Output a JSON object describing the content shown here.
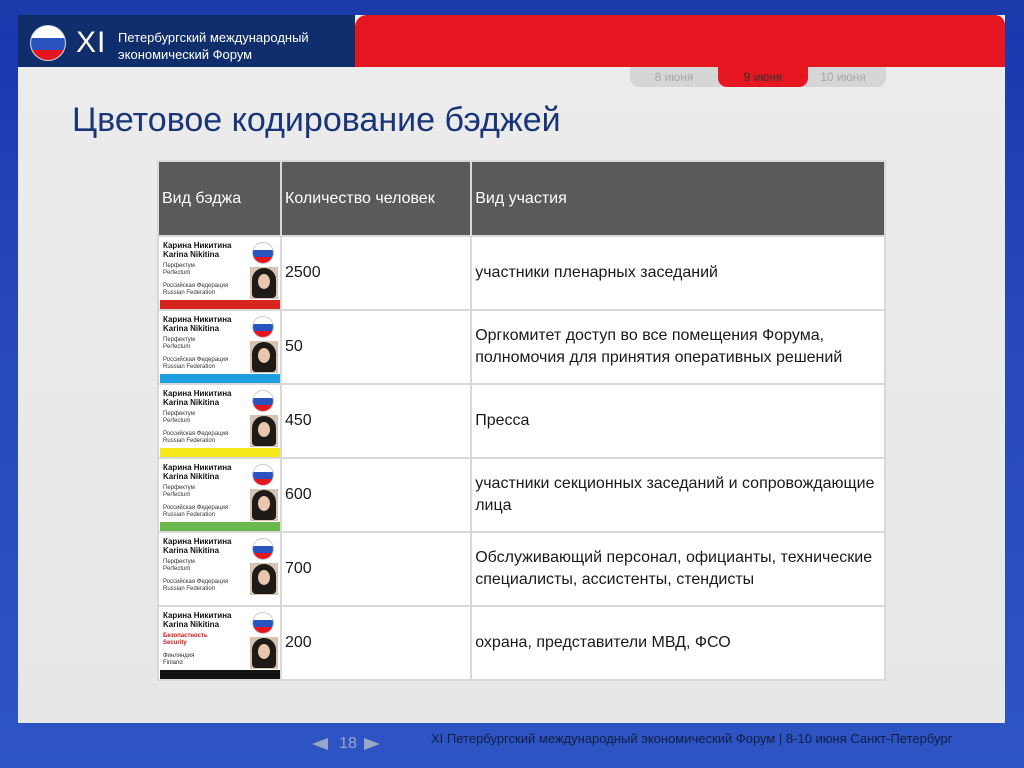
{
  "header": {
    "roman": "XI",
    "forum_name_line1": "Петербургский международный",
    "forum_name_line2": "экономический Форум"
  },
  "tabs": [
    "8 июня",
    "9 июня",
    "10 июня"
  ],
  "active_tab": "9 июня",
  "title": "Цветовое кодирование бэджей",
  "table": {
    "headers": [
      "Вид бэджа",
      "Количество человек",
      "Вид участия"
    ],
    "rows": [
      {
        "badge": {
          "name_ru": "Карина Никитина",
          "name_en": "Karina Nikitina",
          "org_ru": "Перфектум",
          "org_en": "Perfectum",
          "country_ru": "Российская Федерация",
          "country_en": "Russian Federation",
          "stripe_color": "#d7261e"
        },
        "count": "2500",
        "participation": "участники пленарных заседаний"
      },
      {
        "badge": {
          "name_ru": "Карина Никитина",
          "name_en": "Karina Nikitina",
          "org_ru": "Перфектум",
          "org_en": "Perfectum",
          "country_ru": "Российская Федерация",
          "country_en": "Russian Federation",
          "stripe_color": "#1e9fe0"
        },
        "count": "50",
        "participation": "Оргкомитет доступ во все помещения Форума, полномочия для принятия оперативных решений"
      },
      {
        "badge": {
          "name_ru": "Карина Никитина",
          "name_en": "Karina Nikitina",
          "org_ru": "Перфектум",
          "org_en": "Perfectum",
          "country_ru": "Российская Федерация",
          "country_en": "Russian Federation",
          "stripe_color": "#f4e81a"
        },
        "count": "450",
        "participation": "Пресса"
      },
      {
        "badge": {
          "name_ru": "Карина Никитина",
          "name_en": "Karina Nikitina",
          "org_ru": "Перфектум",
          "org_en": "Perfectum",
          "country_ru": "Российская Федерация",
          "country_en": "Russian Federation",
          "stripe_color": "#6ab84e"
        },
        "count": "600",
        "participation": "участники секционных заседаний и сопровождающие лица"
      },
      {
        "badge": {
          "name_ru": "Карина Никитина",
          "name_en": "Karina Nikitina",
          "org_ru": "Перфектум",
          "org_en": "Perfectum",
          "country_ru": "Российская Федерация",
          "country_en": "Russian Federation",
          "stripe_color": "#ffffff"
        },
        "count": "700",
        "participation": "Обслуживающий персонал, официанты, технические специалисты, ассистенты, стендисты"
      },
      {
        "badge": {
          "name_ru": "Карина Никитина",
          "name_en": "Karina Nikitina",
          "org_ru": "Безопастность",
          "org_en": "Security",
          "country_ru": "Финляндия",
          "country_en": "Finland",
          "stripe_color": "#111111",
          "org_color": "red"
        },
        "count": "200",
        "participation": "охрана, представители МВД, ФСО"
      }
    ]
  },
  "footer": {
    "page_number": "18",
    "text": "XI Петербургский международный экономический Форум  |   8-10 июня Санкт-Петербург"
  },
  "colors": {
    "brand_blue": "#0f2e6b",
    "brand_red": "#e5161f",
    "title_blue": "#1a3577",
    "header_gray": "#5a5a5a"
  }
}
